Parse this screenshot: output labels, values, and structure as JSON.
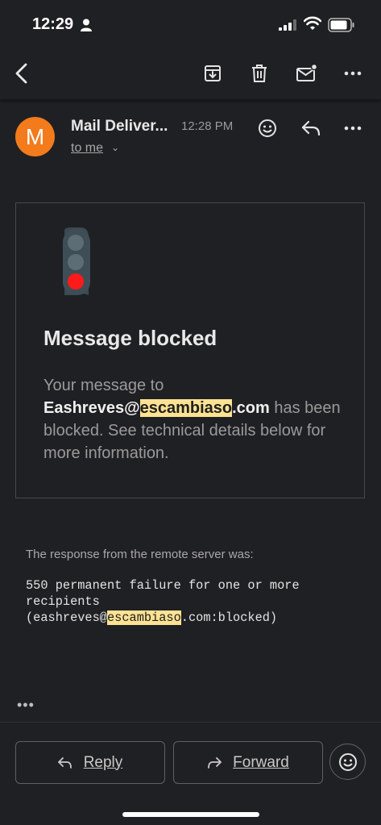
{
  "status_bar": {
    "time": "12:29"
  },
  "sender": {
    "avatar_letter": "M",
    "name": "Mail Deliver...",
    "time": "12:28 PM",
    "to": "to me"
  },
  "card": {
    "title": "Message blocked",
    "body_prefix": "Your message to",
    "email_user": "Eashreves@",
    "email_domain_highlight": "escambiaso",
    "email_tld": ".com",
    "body_suffix": " has been blocked. See technical details below for more information."
  },
  "response": {
    "label": "The response from the remote server was:",
    "code_prefix": "550 permanent failure for one or more recipients\n(eashreves@",
    "code_highlight": "escambiaso",
    "code_suffix": ".com:blocked)"
  },
  "actions": {
    "reply_label": "Reply",
    "forward_label": "Forward"
  },
  "icons": {
    "back": "back-arrow-icon",
    "archive": "archive-icon",
    "delete": "trash-icon",
    "mark_unread": "mark-unread-icon",
    "more": "more-vert-icon",
    "emoji": "emoji-icon",
    "reply": "reply-icon",
    "forward": "forward-icon"
  },
  "colors": {
    "background": "#1f2023",
    "avatar": "#f37b1c",
    "highlight": "#fde293",
    "red_light": "#ff1a1a"
  }
}
